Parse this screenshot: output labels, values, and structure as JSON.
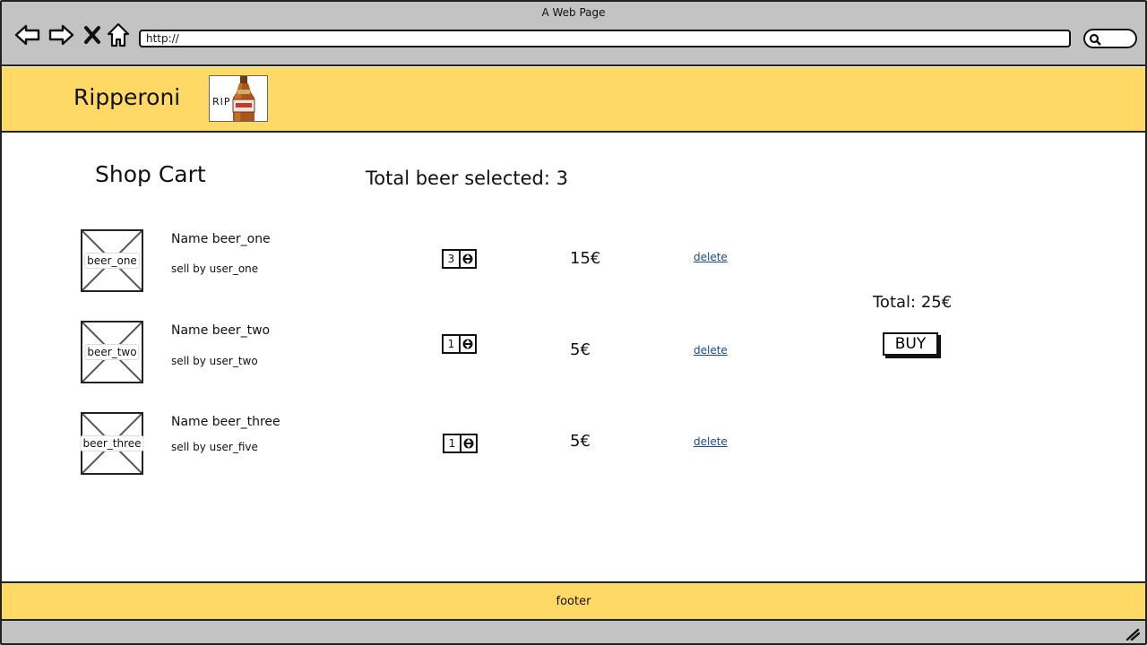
{
  "window": {
    "title": "A Web Page"
  },
  "addressbar": {
    "url": "http://"
  },
  "header": {
    "brand": "Ripperoni",
    "logo_text": "RIP"
  },
  "main": {
    "title": "Shop Cart",
    "total_selected": "Total beer selected: 3"
  },
  "cart": {
    "items": [
      {
        "image_label": "beer_one",
        "name": "Name beer_one",
        "seller": "sell by user_one",
        "quantity": "3",
        "price": "15€",
        "delete_label": "delete"
      },
      {
        "image_label": "beer_two",
        "name": "Name beer_two",
        "seller": "sell by user_two",
        "quantity": "1",
        "price": "5€",
        "delete_label": "delete"
      },
      {
        "image_label": "beer_three",
        "name": "Name beer_three",
        "seller": "sell by user_five",
        "quantity": "1",
        "price": "5€",
        "delete_label": "delete"
      }
    ],
    "total": "Total: 25€",
    "buy_label": "BUY"
  },
  "footer": {
    "text": "footer"
  },
  "colors": {
    "header_bg": "#ffd966",
    "chrome_bg": "#c3c3c3",
    "link": "#1a4a8a"
  },
  "icons": [
    "back-arrow-icon",
    "forward-arrow-icon",
    "close-icon",
    "home-icon",
    "search-icon",
    "spinner-arrows-icon",
    "resize-grip-icon"
  ]
}
